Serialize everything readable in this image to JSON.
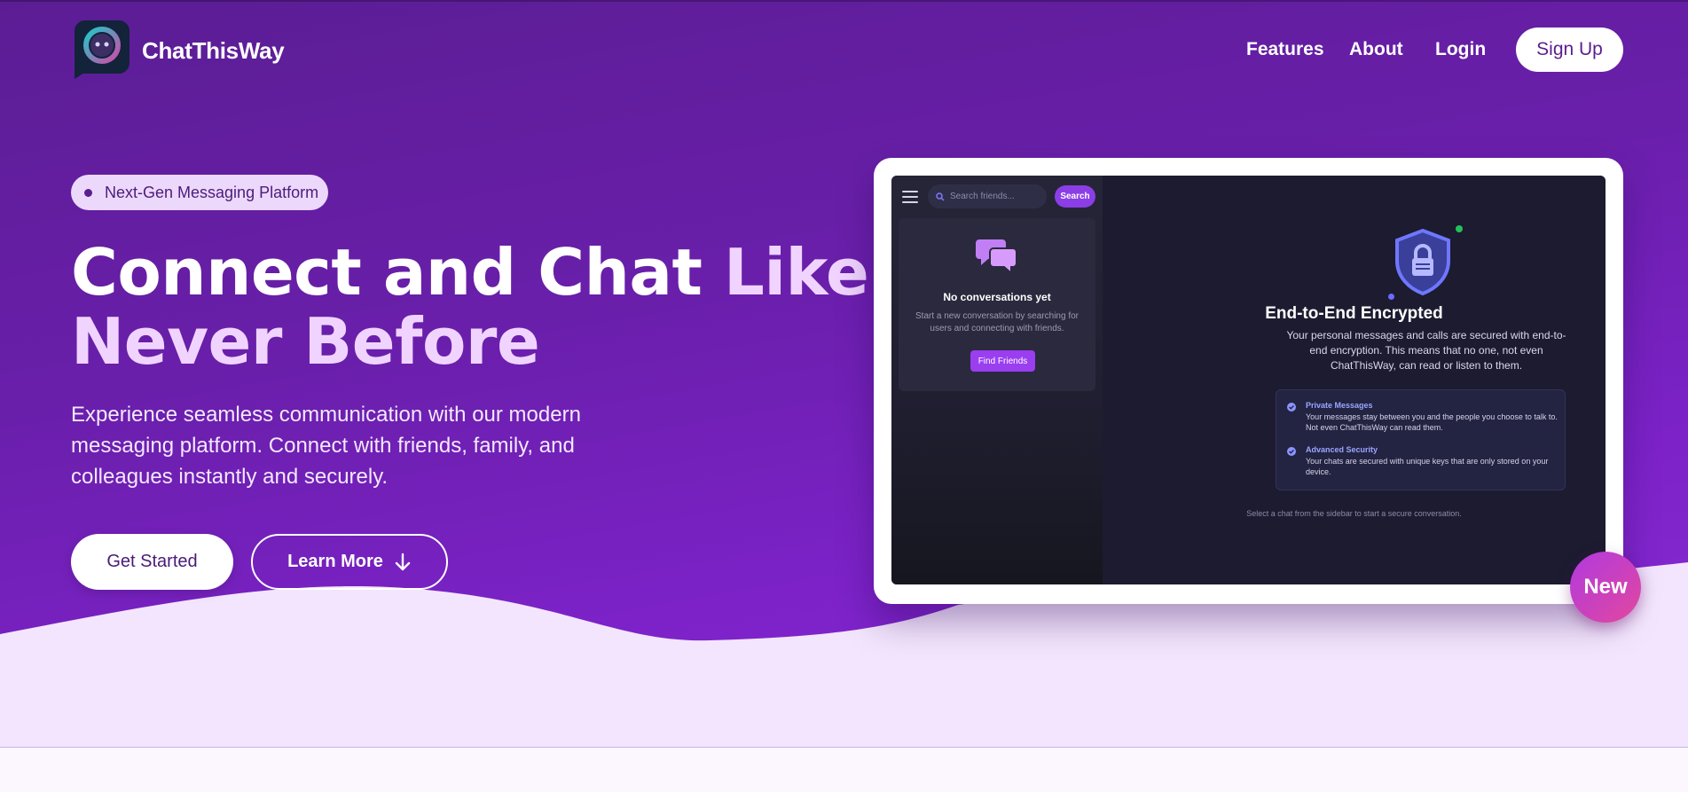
{
  "brand": {
    "name": "ChatThisWay"
  },
  "nav": {
    "features": "Features",
    "about": "About",
    "login": "Login",
    "signup": "Sign Up"
  },
  "hero": {
    "badge": "Next-Gen Messaging Platform",
    "headline_part1": "Connect and Chat ",
    "headline_highlight1": "Like",
    "headline_highlight2": "Never Before",
    "subcopy": "Experience seamless communication with our modern messaging platform. Connect with friends, family, and colleagues instantly and securely.",
    "primary_cta": "Get Started",
    "secondary_cta": "Learn More"
  },
  "preview": {
    "search_placeholder": "Search friends...",
    "search_button": "Search",
    "empty_title": "No conversations yet",
    "empty_desc": "Start a new conversation by searching for users and connecting with friends.",
    "find_button": "Find Friends",
    "enc_title": "End-to-End Encrypted",
    "enc_desc": "Your personal messages and calls are secured with end-to-end encryption. This means that no one, not even ChatThisWay, can read or listen to them.",
    "features": [
      {
        "title": "Private Messages",
        "desc": "Your messages stay between you and the people you choose to talk to. Not even ChatThisWay can read them."
      },
      {
        "title": "Advanced Security",
        "desc": "Your chats are secured with unique keys that are only stored on your device."
      }
    ],
    "hint": "Select a chat from the sidebar to start a secure conversation."
  },
  "new_badge": "New",
  "colors": {
    "hero_start": "#5b1d94",
    "hero_end": "#8a2bd6",
    "highlight": "#f0d4ff",
    "accent": "#8b3ee6",
    "new_badge_start": "#b03ae0",
    "new_badge_end": "#e2479e"
  },
  "icons": {
    "logo": "chat-bubble-logo-icon",
    "learn_more": "arrow-down-icon",
    "menu": "hamburger-menu-icon",
    "search": "search-icon",
    "empty": "chat-bubbles-icon",
    "shield": "shield-lock-icon",
    "check": "check-circle-icon"
  }
}
